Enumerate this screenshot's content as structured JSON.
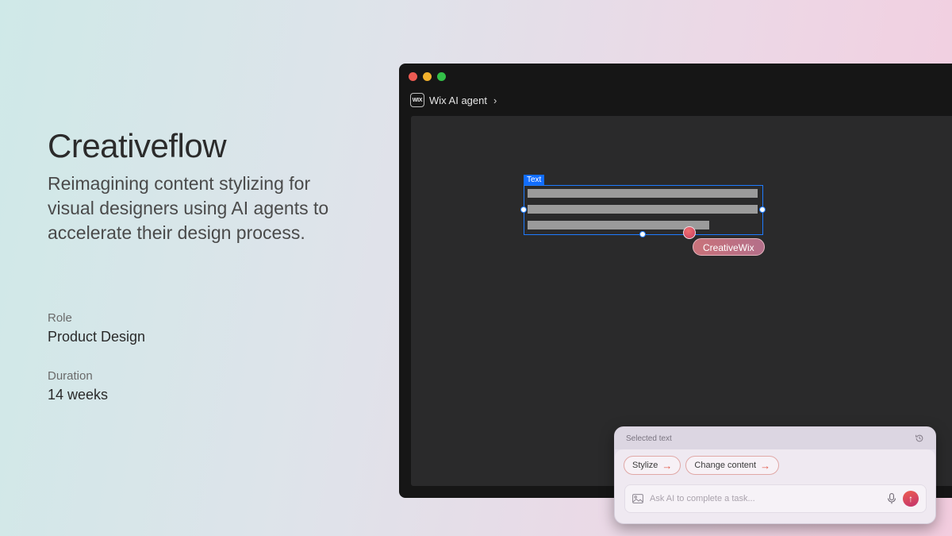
{
  "project": {
    "title": "Creativeflow",
    "subtitle": "Reimagining content stylizing for visual designers using AI agents to accelerate their design process.",
    "role_label": "Role",
    "role_value": "Product Design",
    "duration_label": "Duration",
    "duration_value": "14 weeks"
  },
  "window": {
    "logo_text": "WIX",
    "app_name": "Wix AI agent",
    "chevron": "›",
    "selection_tag": "Text",
    "collaborator_label": "CreativeWix"
  },
  "ai_panel": {
    "header": "Selected text",
    "chips": [
      {
        "label": "Stylize",
        "arrow": "→"
      },
      {
        "label": "Change content",
        "arrow": "→"
      }
    ],
    "input_placeholder": "Ask AI to complete a task...",
    "send_glyph": "↑"
  },
  "colors": {
    "selection": "#116dff",
    "accent": "#e25a4a",
    "window_bg": "#161616",
    "canvas_bg": "#2a2a2b"
  },
  "icons": [
    "history-icon",
    "image-icon",
    "microphone-icon",
    "send-icon",
    "chevron-right-icon"
  ]
}
